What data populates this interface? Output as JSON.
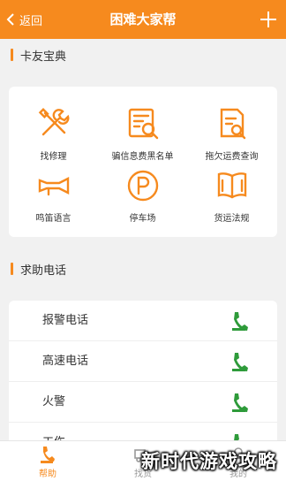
{
  "header": {
    "back_label": "返回",
    "title": "困难大家帮"
  },
  "sections": {
    "manual_title": "卡友宝典",
    "help_title": "求助电话"
  },
  "manual_items": [
    {
      "label": "找修理",
      "icon": "repair-tools-icon"
    },
    {
      "label": "骗信息费黑名单",
      "icon": "blacklist-search-icon"
    },
    {
      "label": "拖欠运费查询",
      "icon": "freight-search-icon"
    },
    {
      "label": "鸣笛语言",
      "icon": "horn-icon"
    },
    {
      "label": "停车场",
      "icon": "parking-icon"
    },
    {
      "label": "货运法规",
      "icon": "regulation-book-icon"
    }
  ],
  "help_items": [
    {
      "label": "报警电话"
    },
    {
      "label": "高速电话"
    },
    {
      "label": "火警"
    },
    {
      "label": "工伤..."
    }
  ],
  "tabbar": {
    "tabs": [
      {
        "label": "帮助",
        "active": true
      },
      {
        "label": "找货",
        "active": false
      },
      {
        "label": "我的",
        "active": false
      }
    ]
  },
  "watermark": "新时代游戏攻略",
  "colors": {
    "accent": "#f68a1e",
    "phone_green": "#2e9b3a"
  }
}
